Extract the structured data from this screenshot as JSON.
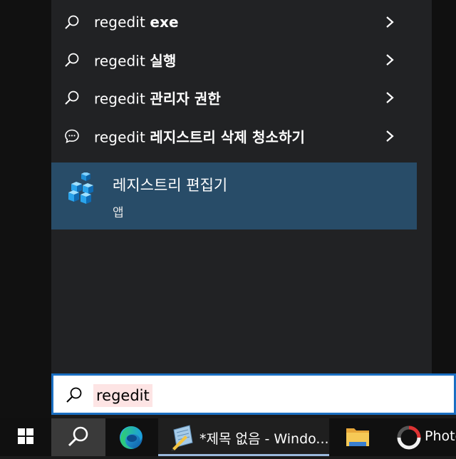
{
  "search_flyout": {
    "suggestions": [
      {
        "icon": "search-icon",
        "query": "regedit",
        "suffix": "exe"
      },
      {
        "icon": "search-icon",
        "query": "regedit",
        "suffix": "실행"
      },
      {
        "icon": "search-icon",
        "query": "regedit",
        "suffix": "관리자 권한"
      },
      {
        "icon": "chat-bubble-icon",
        "query": "regedit",
        "suffix": "레지스트리 삭제 청소하기"
      }
    ],
    "best_match": {
      "name": "레지스트리 편집기",
      "type": "앱"
    }
  },
  "search_box": {
    "query": "regedit"
  },
  "taskbar": {
    "items": [
      {
        "name": "start",
        "label": ""
      },
      {
        "name": "search",
        "label": ""
      },
      {
        "name": "edge",
        "label": ""
      },
      {
        "name": "notepad",
        "label": "*제목 없음 - Windo..."
      },
      {
        "name": "file-explorer",
        "label": ""
      },
      {
        "name": "photo",
        "label": "Photo"
      }
    ]
  },
  "colors": {
    "best_match_bg": "#284c68",
    "search_border": "#1a6fc2",
    "query_highlight": "#fde4e4"
  }
}
